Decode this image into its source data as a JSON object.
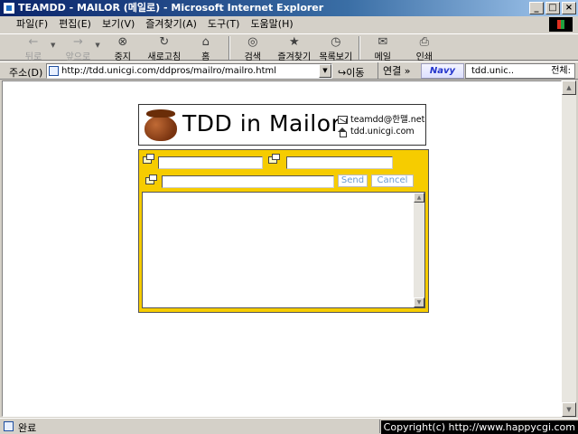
{
  "window": {
    "title": "TEAMDD - MAILOR (메일로) - Microsoft Internet Explorer",
    "controls": {
      "minimize": "_",
      "maximize": "□",
      "close": "×"
    }
  },
  "menu": [
    "파일(F)",
    "편집(E)",
    "보기(V)",
    "즐겨찾기(A)",
    "도구(T)",
    "도움말(H)"
  ],
  "toolbar": {
    "back": "뒤로",
    "forward": "앞으로",
    "stop": "중지",
    "refresh": "새로고침",
    "home": "홈",
    "search": "검색",
    "favorites": "즐겨찾기",
    "history": "목록보기",
    "mail": "메일",
    "print": "인쇄"
  },
  "address": {
    "label": "주소(D)",
    "url": "http://tdd.unicgi.com/ddpros/mailro/mailro.html",
    "go": "이동",
    "links": "연결 »",
    "search_brand": "Navy",
    "search_text": "tdd.unic..",
    "search_scope": "전체:"
  },
  "banner": {
    "title": "TDD in Mailor",
    "email": "teamdd@한맬.net",
    "site": "tdd.unicgi.com"
  },
  "form": {
    "to_value": "",
    "from_value": "",
    "subject_value": "",
    "send_label": "Send",
    "cancel_label": "Cancel",
    "body_value": ""
  },
  "status": {
    "text": "완료",
    "copyright": "Copyright(c) http://www.happycgi.com"
  },
  "colors": {
    "panel": "#f6cc00",
    "title_bar": "#0a246a",
    "button_text": "#6a9ad0"
  }
}
